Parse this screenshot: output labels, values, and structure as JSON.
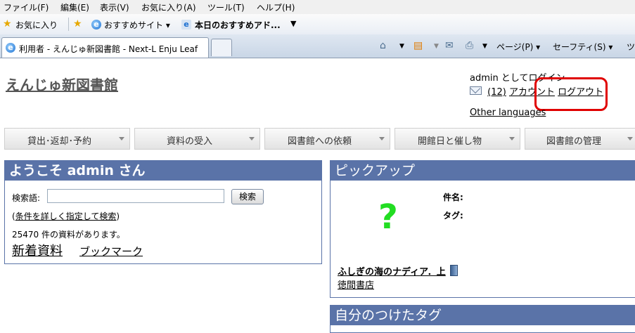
{
  "browser": {
    "menu": [
      "ファイル(F)",
      "編集(E)",
      "表示(V)",
      "お気に入り(A)",
      "ツール(T)",
      "ヘルプ(H)"
    ],
    "favorites": {
      "label": "お気に入り",
      "items": [
        "おすすめサイト ▾",
        "本日のおすすめアド..."
      ]
    },
    "tab_title": "利用者 - えんじゅ新図書館 - Next-L Enju Leaf",
    "commands": {
      "page": "ページ(P) ▾",
      "safety": "セーフティ(S) ▾",
      "tools_partial": "ツ"
    }
  },
  "site": {
    "title": "えんじゅ新図書館"
  },
  "user": {
    "login_status": "admin としてログイン",
    "message_count": "(12)",
    "account": "アカウント",
    "logout": "ログアウト",
    "other_languages": "Other languages"
  },
  "nav": [
    "貸出･返却･予約",
    "資料の受入",
    "図書館への依頼",
    "開館日と催し物",
    "図書館の管理"
  ],
  "welcome": {
    "heading": "ようこそ admin さん",
    "search_label": "検索語:",
    "search_value": "",
    "search_button": "検索",
    "advanced_open": "(",
    "advanced_link": "条件を詳しく指定して検索",
    "advanced_close": ")",
    "count": "25470 件の資料があります。",
    "new_items": "新着資料",
    "bookmarks": "ブックマーク"
  },
  "pickup": {
    "heading": "ピックアップ",
    "placeholder": "?",
    "title_label": "件名:",
    "tag_label": "タグ:",
    "book_title": "ふしぎの海のナディア．上",
    "publisher": "徳間書店"
  },
  "my_tags": {
    "heading": "自分のつけたタグ"
  },
  "colors": {
    "panel_header": "#5a73a8",
    "annotation_circle": "#e00000",
    "placeholder_mark": "#22dd22"
  }
}
